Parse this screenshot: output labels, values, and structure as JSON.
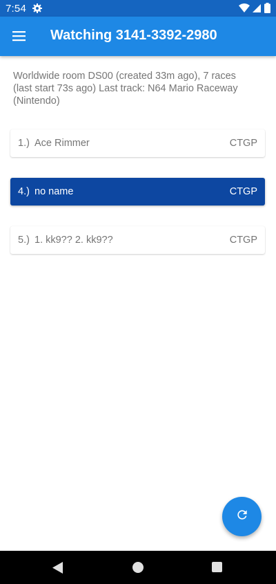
{
  "status_bar": {
    "time": "7:54",
    "icons": [
      "gear-icon",
      "wifi-icon",
      "signal-icon",
      "battery-icon"
    ]
  },
  "app_bar": {
    "title": "Watching 3141-3392-2980",
    "menu_icon": "hamburger-menu-icon"
  },
  "room": {
    "info": "Worldwide room DS00 (created 33m ago), 7 races (last start 73s ago) Last track: N64 Mario Raceway (Nintendo)"
  },
  "players": [
    {
      "position": "1.)",
      "name": "Ace Rimmer",
      "tag": "CTGP",
      "selected": false
    },
    {
      "position": "4.)",
      "name": "no name",
      "tag": "CTGP",
      "selected": true
    },
    {
      "position": "5.)",
      "name": "1. kk9?? 2. kk9??",
      "tag": "CTGP",
      "selected": false
    }
  ],
  "fab": {
    "icon": "refresh-icon"
  },
  "colors": {
    "status_bar": "#1565c0",
    "app_bar": "#1e88e5",
    "selected_card": "#0d47a1",
    "text_secondary": "#757575"
  }
}
